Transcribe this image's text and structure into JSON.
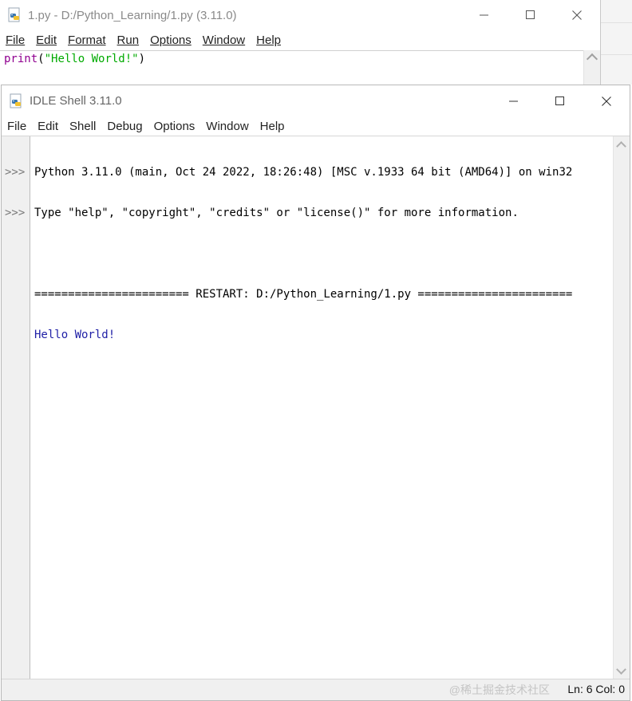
{
  "colors": {
    "builtin": "#900090",
    "string": "#00aa00",
    "stdout": "#1f1fa6",
    "prompt": "#7a7a7a"
  },
  "editor": {
    "title": "1.py - D:/Python_Learning/1.py (3.11.0)",
    "menu": [
      "File",
      "Edit",
      "Format",
      "Run",
      "Options",
      "Window",
      "Help"
    ],
    "code_builtin": "print",
    "code_open": "(",
    "code_string": "\"Hello World!\"",
    "code_close": ")"
  },
  "shell": {
    "title": "IDLE Shell 3.11.0",
    "menu": [
      "File",
      "Edit",
      "Shell",
      "Debug",
      "Options",
      "Window",
      "Help"
    ],
    "prompt": ">>>",
    "lines": [
      "Python 3.11.0 (main, Oct 24 2022, 18:26:48) [MSC v.1933 64 bit (AMD64)] on win32",
      "Type \"help\", \"copyright\", \"credits\" or \"license()\" for more information.",
      "",
      "======================= RESTART: D:/Python_Learning/1.py ======================="
    ],
    "output": "Hello World!",
    "status": "Ln: 6  Col: 0",
    "watermark": "@稀土掘金技术社区"
  },
  "icons": {
    "app": "python-file-icon",
    "minimize": "minimize-icon",
    "maximize": "maximize-icon",
    "close": "close-icon"
  }
}
